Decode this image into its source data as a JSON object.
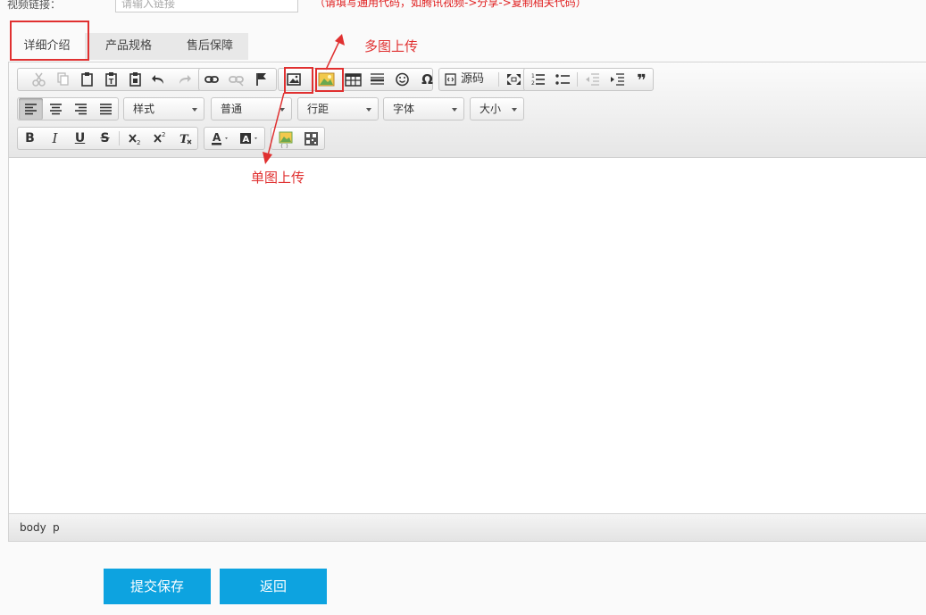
{
  "form": {
    "video_label": "视频链接：",
    "video_placeholder": "请输入链接",
    "video_hint": "（请填写通用代码，如腾讯视频->分享->复制相关代码）"
  },
  "tabs": [
    {
      "label": "详细介绍",
      "active": true
    },
    {
      "label": "产品规格",
      "active": false
    },
    {
      "label": "售后保障",
      "active": false
    }
  ],
  "toolbar": {
    "source_label": "源码",
    "combos": {
      "style": "样式",
      "paragraph": "普通",
      "line_height": "行距",
      "font": "字体",
      "size": "大小"
    },
    "format": {
      "bold": "B",
      "italic": "I",
      "underline": "U",
      "strike": "S",
      "omega": "Ω",
      "quote": "❞"
    }
  },
  "annotations": {
    "multi_upload": "多图上传",
    "single_upload": "单图上传"
  },
  "statusbar": {
    "path": [
      "body",
      "p"
    ]
  },
  "actions": {
    "submit": "提交保存",
    "back": "返回"
  },
  "colors": {
    "accent": "#0da3e0",
    "annotation": "#e03030"
  }
}
